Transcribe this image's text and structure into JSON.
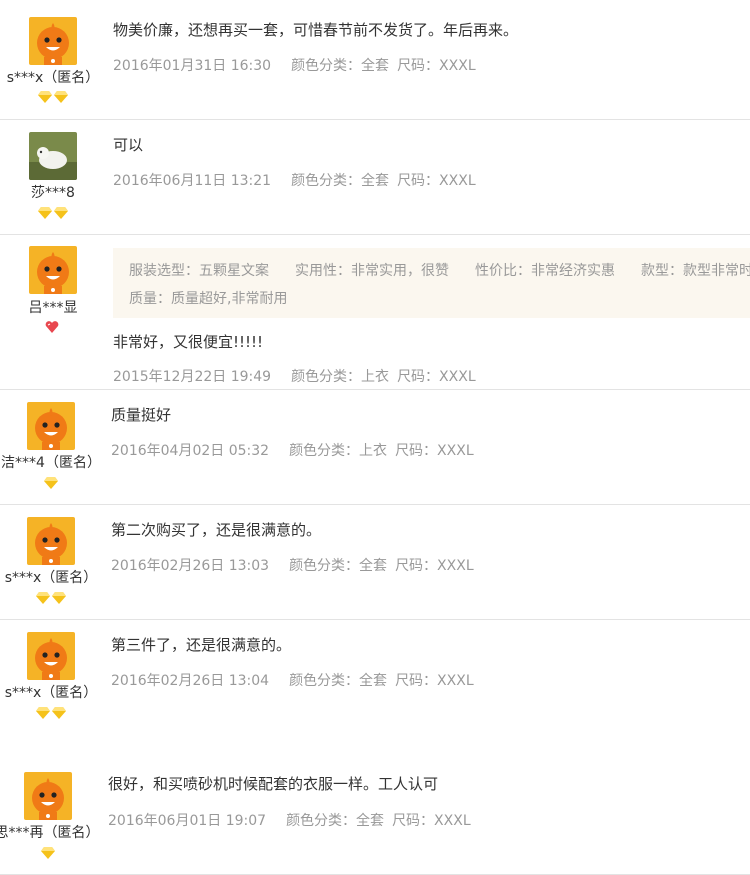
{
  "reviews": [
    {
      "user": "s***x（匿名）",
      "text": "物美价廉，还想再买一套，可惜春节前不发货了。年后再来。",
      "date": "2016年01月31日 16:30",
      "color": "颜色分类：全套",
      "size": "尺码：XXXL"
    },
    {
      "user": "莎***8",
      "text": "可以",
      "date": "2016年06月11日 13:21",
      "color": "颜色分类：全套",
      "size": "尺码：XXXL"
    },
    {
      "user": "吕***显",
      "text": "非常好，又很便宜!!!!!",
      "date": "2015年12月22日 19:49",
      "color": "颜色分类：上衣",
      "size": "尺码：XXXL",
      "attrs": [
        "服装选型：五颗星文案",
        "实用性：非常实用，很赞",
        "性价比：非常经济实惠",
        "款型：款型非常时",
        "质量：质量超好,非常耐用"
      ]
    },
    {
      "user": "洁***4（匿名）",
      "text": "质量挺好",
      "date": "2016年04月02日 05:32",
      "color": "颜色分类：上衣",
      "size": "尺码：XXXL"
    },
    {
      "user": "s***x（匿名）",
      "text": "第二次购买了，还是很满意的。",
      "date": "2016年02月26日 13:03",
      "color": "颜色分类：全套",
      "size": "尺码：XXXL"
    },
    {
      "user": "s***x（匿名）",
      "text": "第三件了，还是很满意的。",
      "date": "2016年02月26日 13:04",
      "color": "颜色分类：全套",
      "size": "尺码：XXXL"
    },
    {
      "user": "思***再（匿名）",
      "text": "很好，和买喷砂机时候配套的衣服一样。工人认可",
      "date": "2016年06月01日 19:07",
      "color": "颜色分类：全套",
      "size": "尺码：XXXL"
    }
  ],
  "colors": {
    "avatar_bg": "#f5b326",
    "mascot": "#f07a16",
    "diamond": "#f5c21a",
    "heart": "#e8474f"
  }
}
